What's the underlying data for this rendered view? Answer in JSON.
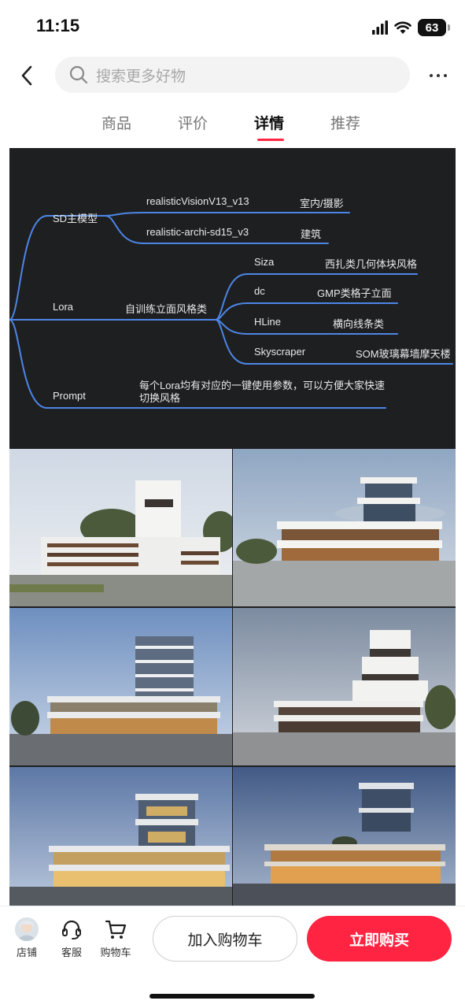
{
  "status_bar": {
    "time": "11:15",
    "battery": "63"
  },
  "nav": {
    "search_placeholder": "搜索更多好物"
  },
  "tabs": [
    {
      "label": "商品"
    },
    {
      "label": "评价"
    },
    {
      "label": "详情"
    },
    {
      "label": "推荐"
    }
  ],
  "active_tab": "详情",
  "mindmap": {
    "sd_model": {
      "label": "SD主模型",
      "branches": [
        {
          "name": "realisticVisionV13_v13",
          "desc": "室内/摄影"
        },
        {
          "name": "realistic-archi-sd15_v3",
          "desc": "建筑"
        }
      ]
    },
    "lora": {
      "label": "Lora",
      "sub_label": "自训练立面风格类",
      "branches": [
        {
          "name": "Siza",
          "desc": "西扎类几何体块风格"
        },
        {
          "name": "dc",
          "desc": "GMP类格子立面"
        },
        {
          "name": "HLine",
          "desc": "横向线条类"
        },
        {
          "name": "Skyscraper",
          "desc": "SOM玻璃幕墙摩天楼"
        }
      ]
    },
    "prompt": {
      "label": "Prompt",
      "desc_line1": "每个Lora均有对应的一键使用参数，可以方便大家快速",
      "desc_line2": "切换风格"
    },
    "line_color": "#4d86e6"
  },
  "bottom_bar": {
    "store_label": "店铺",
    "service_label": "客服",
    "cart_label": "购物车",
    "add_cart_label": "加入购物车",
    "buy_now_label": "立即购买",
    "accent_color": "#ff2442"
  }
}
